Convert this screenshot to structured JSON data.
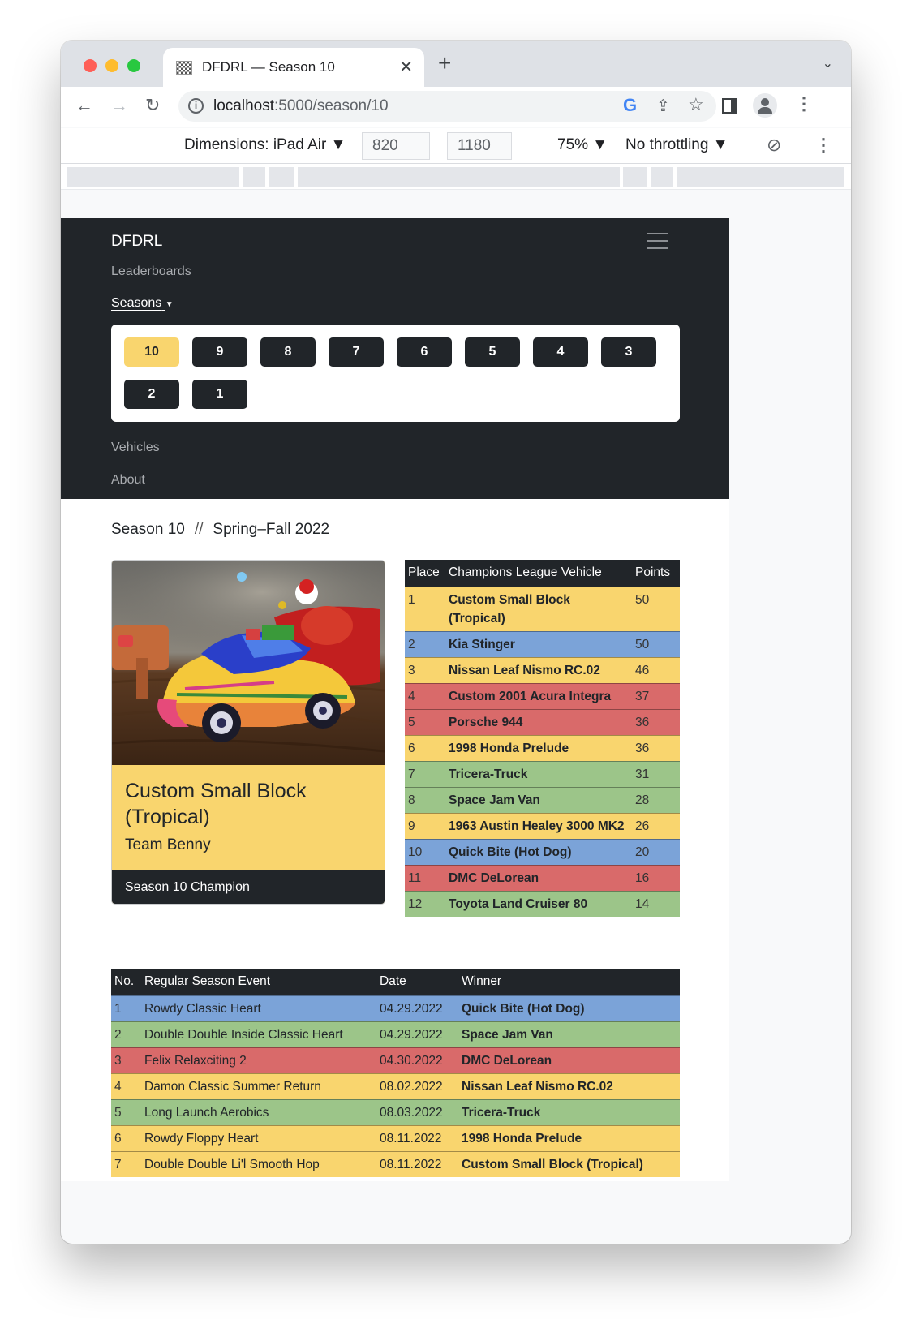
{
  "browser": {
    "tab_title": "DFDRL — Season 10",
    "url_host": "localhost",
    "url_path": ":5000/season/10",
    "devtools": {
      "dimensions_label": "Dimensions: iPad Air ▼",
      "width": "820",
      "height": "1180",
      "zoom": "75% ▼",
      "throttling": "No throttling ▼"
    }
  },
  "navbar": {
    "brand": "DFDRL",
    "links": [
      "Leaderboards",
      "Seasons",
      "Vehicles",
      "About"
    ],
    "seasons": [
      "10",
      "9",
      "8",
      "7",
      "6",
      "5",
      "4",
      "3",
      "2",
      "1"
    ],
    "active_season": "10"
  },
  "heading": {
    "season": "Season 10",
    "separator": "//",
    "range": "Spring–Fall 2022"
  },
  "champion_card": {
    "title": "Custom Small Block (Tropical)",
    "team": "Team Benny",
    "footer": "Season 10 Champion"
  },
  "champions_table": {
    "headers": [
      "Place",
      "Champions League Vehicle",
      "Points"
    ],
    "rows": [
      {
        "place": "1",
        "vehicle": "Custom Small Block (Tropical)",
        "points": "50",
        "color": "yellow"
      },
      {
        "place": "2",
        "vehicle": "Kia Stinger",
        "points": "50",
        "color": "blue"
      },
      {
        "place": "3",
        "vehicle": "Nissan Leaf Nismo RC.02",
        "points": "46",
        "color": "yellow"
      },
      {
        "place": "4",
        "vehicle": "Custom 2001 Acura Integra",
        "points": "37",
        "color": "red"
      },
      {
        "place": "5",
        "vehicle": "Porsche 944",
        "points": "36",
        "color": "red"
      },
      {
        "place": "6",
        "vehicle": "1998 Honda Prelude",
        "points": "36",
        "color": "yellow"
      },
      {
        "place": "7",
        "vehicle": "Tricera-Truck",
        "points": "31",
        "color": "green"
      },
      {
        "place": "8",
        "vehicle": "Space Jam Van",
        "points": "28",
        "color": "green"
      },
      {
        "place": "9",
        "vehicle": "1963 Austin Healey 3000 MK2",
        "points": "26",
        "color": "yellow"
      },
      {
        "place": "10",
        "vehicle": "Quick Bite (Hot Dog)",
        "points": "20",
        "color": "blue"
      },
      {
        "place": "11",
        "vehicle": "DMC DeLorean",
        "points": "16",
        "color": "red"
      },
      {
        "place": "12",
        "vehicle": "Toyota Land Cruiser 80",
        "points": "14",
        "color": "green"
      }
    ]
  },
  "events_table": {
    "headers": [
      "No.",
      "Regular Season Event",
      "Date",
      "Winner"
    ],
    "rows": [
      {
        "no": "1",
        "event": "Rowdy Classic Heart",
        "date": "04.29.2022",
        "winner": "Quick Bite (Hot Dog)",
        "color": "blue"
      },
      {
        "no": "2",
        "event": "Double Double Inside Classic Heart",
        "date": "04.29.2022",
        "winner": "Space Jam Van",
        "color": "green"
      },
      {
        "no": "3",
        "event": "Felix Relaxciting 2",
        "date": "04.30.2022",
        "winner": "DMC DeLorean",
        "color": "red"
      },
      {
        "no": "4",
        "event": "Damon Classic Summer Return",
        "date": "08.02.2022",
        "winner": "Nissan Leaf Nismo RC.02",
        "color": "yellow"
      },
      {
        "no": "5",
        "event": "Long Launch Aerobics",
        "date": "08.03.2022",
        "winner": "Tricera-Truck",
        "color": "green"
      },
      {
        "no": "6",
        "event": "Rowdy Floppy Heart",
        "date": "08.11.2022",
        "winner": "1998 Honda Prelude",
        "color": "yellow"
      },
      {
        "no": "7",
        "event": "Double Double Li'l Smooth Hop",
        "date": "08.11.2022",
        "winner": "Custom Small Block (Tropical)",
        "color": "yellow"
      }
    ]
  }
}
